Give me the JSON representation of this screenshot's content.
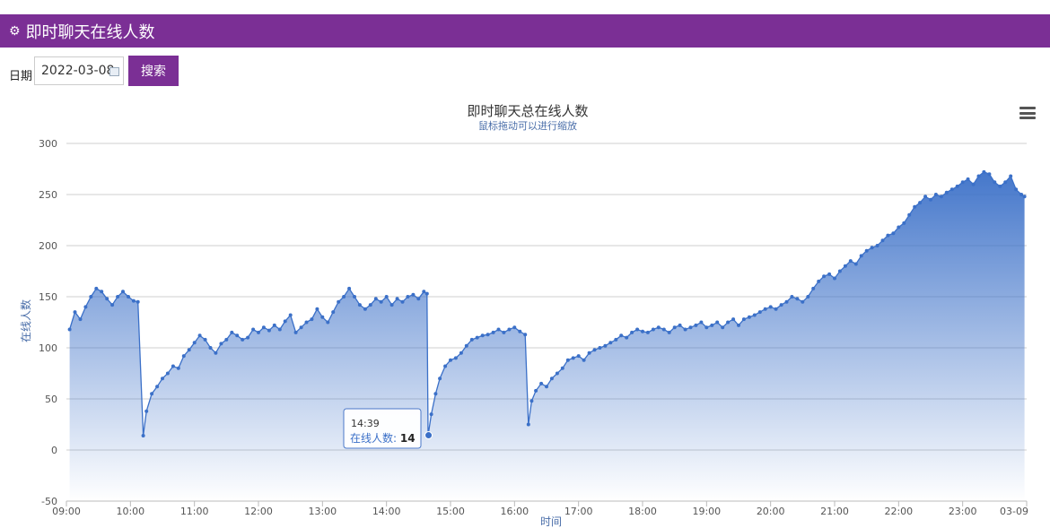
{
  "header": {
    "title": "即时聊天在线人数",
    "icon": "cogs-icon"
  },
  "toolbar": {
    "date_label": "日期",
    "date_value": "2022-03-08",
    "search_label": "搜索"
  },
  "colors": {
    "brand": "#7b2f95",
    "series": "#3b70c8"
  },
  "chart_data": {
    "type": "area",
    "title": "即时聊天总在线人数",
    "subtitle": "鼠标拖动可以进行缩放",
    "xlabel": "时间",
    "ylabel": "在线人数",
    "ylim": [
      -50,
      300
    ],
    "yticks": [
      -50,
      0,
      50,
      100,
      150,
      200,
      250,
      300
    ],
    "xlim": [
      "09:00",
      "24:00"
    ],
    "xticks": [
      {
        "t": "09:00",
        "label": "09:00"
      },
      {
        "t": "10:00",
        "label": "10:00"
      },
      {
        "t": "11:00",
        "label": "11:00"
      },
      {
        "t": "12:00",
        "label": "12:00"
      },
      {
        "t": "13:00",
        "label": "13:00"
      },
      {
        "t": "14:00",
        "label": "14:00"
      },
      {
        "t": "15:00",
        "label": "15:00"
      },
      {
        "t": "16:00",
        "label": "16:00"
      },
      {
        "t": "17:00",
        "label": "17:00"
      },
      {
        "t": "18:00",
        "label": "18:00"
      },
      {
        "t": "19:00",
        "label": "19:00"
      },
      {
        "t": "20:00",
        "label": "20:00"
      },
      {
        "t": "21:00",
        "label": "21:00"
      },
      {
        "t": "22:00",
        "label": "22:00"
      },
      {
        "t": "23:00",
        "label": "23:00"
      },
      {
        "t": "24:00",
        "label": "03-09"
      }
    ],
    "grid": true,
    "legend": false,
    "series": [
      {
        "values": [
          [
            "09:03",
            118
          ],
          [
            "09:08",
            135
          ],
          [
            "09:13",
            128
          ],
          [
            "09:18",
            140
          ],
          [
            "09:23",
            150
          ],
          [
            "09:28",
            158
          ],
          [
            "09:33",
            155
          ],
          [
            "09:38",
            148
          ],
          [
            "09:43",
            142
          ],
          [
            "09:48",
            150
          ],
          [
            "09:53",
            155
          ],
          [
            "09:58",
            150
          ],
          [
            "10:03",
            146
          ],
          [
            "10:07",
            145
          ],
          [
            "10:12",
            14
          ],
          [
            "10:15",
            38
          ],
          [
            "10:20",
            55
          ],
          [
            "10:25",
            62
          ],
          [
            "10:30",
            70
          ],
          [
            "10:35",
            75
          ],
          [
            "10:40",
            82
          ],
          [
            "10:45",
            80
          ],
          [
            "10:50",
            92
          ],
          [
            "10:55",
            98
          ],
          [
            "11:00",
            105
          ],
          [
            "11:05",
            112
          ],
          [
            "11:10",
            108
          ],
          [
            "11:15",
            100
          ],
          [
            "11:20",
            95
          ],
          [
            "11:25",
            104
          ],
          [
            "11:30",
            108
          ],
          [
            "11:35",
            115
          ],
          [
            "11:40",
            112
          ],
          [
            "11:45",
            108
          ],
          [
            "11:50",
            110
          ],
          [
            "11:55",
            118
          ],
          [
            "12:00",
            115
          ],
          [
            "12:05",
            120
          ],
          [
            "12:10",
            117
          ],
          [
            "12:15",
            122
          ],
          [
            "12:20",
            118
          ],
          [
            "12:25",
            126
          ],
          [
            "12:30",
            132
          ],
          [
            "12:35",
            115
          ],
          [
            "12:40",
            120
          ],
          [
            "12:45",
            125
          ],
          [
            "12:50",
            128
          ],
          [
            "12:55",
            138
          ],
          [
            "13:00",
            130
          ],
          [
            "13:05",
            125
          ],
          [
            "13:10",
            135
          ],
          [
            "13:15",
            145
          ],
          [
            "13:20",
            150
          ],
          [
            "13:25",
            158
          ],
          [
            "13:30",
            150
          ],
          [
            "13:35",
            142
          ],
          [
            "13:40",
            138
          ],
          [
            "13:45",
            142
          ],
          [
            "13:50",
            148
          ],
          [
            "13:55",
            145
          ],
          [
            "14:00",
            150
          ],
          [
            "14:05",
            142
          ],
          [
            "14:10",
            148
          ],
          [
            "14:15",
            145
          ],
          [
            "14:20",
            150
          ],
          [
            "14:25",
            152
          ],
          [
            "14:30",
            148
          ],
          [
            "14:35",
            155
          ],
          [
            "14:38",
            153
          ],
          [
            "14:39",
            14
          ],
          [
            "14:42",
            35
          ],
          [
            "14:46",
            55
          ],
          [
            "14:50",
            70
          ],
          [
            "14:55",
            82
          ],
          [
            "15:00",
            88
          ],
          [
            "15:05",
            90
          ],
          [
            "15:10",
            95
          ],
          [
            "15:15",
            102
          ],
          [
            "15:20",
            108
          ],
          [
            "15:25",
            110
          ],
          [
            "15:30",
            112
          ],
          [
            "15:35",
            113
          ],
          [
            "15:40",
            115
          ],
          [
            "15:45",
            118
          ],
          [
            "15:50",
            115
          ],
          [
            "15:55",
            118
          ],
          [
            "16:00",
            120
          ],
          [
            "16:05",
            116
          ],
          [
            "16:10",
            113
          ],
          [
            "16:13",
            25
          ],
          [
            "16:16",
            48
          ],
          [
            "16:20",
            58
          ],
          [
            "16:25",
            65
          ],
          [
            "16:30",
            62
          ],
          [
            "16:35",
            70
          ],
          [
            "16:40",
            75
          ],
          [
            "16:45",
            80
          ],
          [
            "16:50",
            88
          ],
          [
            "16:55",
            90
          ],
          [
            "17:00",
            92
          ],
          [
            "17:05",
            88
          ],
          [
            "17:10",
            95
          ],
          [
            "17:15",
            98
          ],
          [
            "17:20",
            100
          ],
          [
            "17:25",
            102
          ],
          [
            "17:30",
            105
          ],
          [
            "17:35",
            108
          ],
          [
            "17:40",
            112
          ],
          [
            "17:45",
            110
          ],
          [
            "17:50",
            115
          ],
          [
            "17:55",
            118
          ],
          [
            "18:00",
            116
          ],
          [
            "18:05",
            115
          ],
          [
            "18:10",
            118
          ],
          [
            "18:15",
            120
          ],
          [
            "18:20",
            118
          ],
          [
            "18:25",
            115
          ],
          [
            "18:30",
            120
          ],
          [
            "18:35",
            122
          ],
          [
            "18:40",
            118
          ],
          [
            "18:45",
            120
          ],
          [
            "18:50",
            122
          ],
          [
            "18:55",
            125
          ],
          [
            "19:00",
            120
          ],
          [
            "19:05",
            122
          ],
          [
            "19:10",
            125
          ],
          [
            "19:15",
            120
          ],
          [
            "19:20",
            125
          ],
          [
            "19:25",
            128
          ],
          [
            "19:30",
            122
          ],
          [
            "19:35",
            128
          ],
          [
            "19:40",
            130
          ],
          [
            "19:45",
            132
          ],
          [
            "19:50",
            135
          ],
          [
            "19:55",
            138
          ],
          [
            "20:00",
            140
          ],
          [
            "20:05",
            138
          ],
          [
            "20:10",
            142
          ],
          [
            "20:15",
            145
          ],
          [
            "20:20",
            150
          ],
          [
            "20:25",
            148
          ],
          [
            "20:30",
            145
          ],
          [
            "20:35",
            150
          ],
          [
            "20:40",
            158
          ],
          [
            "20:45",
            165
          ],
          [
            "20:50",
            170
          ],
          [
            "20:55",
            172
          ],
          [
            "21:00",
            168
          ],
          [
            "21:05",
            175
          ],
          [
            "21:10",
            180
          ],
          [
            "21:15",
            185
          ],
          [
            "21:20",
            182
          ],
          [
            "21:25",
            190
          ],
          [
            "21:30",
            195
          ],
          [
            "21:35",
            198
          ],
          [
            "21:40",
            200
          ],
          [
            "21:45",
            205
          ],
          [
            "21:50",
            210
          ],
          [
            "21:55",
            212
          ],
          [
            "22:00",
            218
          ],
          [
            "22:05",
            222
          ],
          [
            "22:10",
            230
          ],
          [
            "22:15",
            238
          ],
          [
            "22:20",
            242
          ],
          [
            "22:25",
            248
          ],
          [
            "22:30",
            245
          ],
          [
            "22:35",
            250
          ],
          [
            "22:40",
            248
          ],
          [
            "22:45",
            252
          ],
          [
            "22:50",
            255
          ],
          [
            "22:55",
            258
          ],
          [
            "23:00",
            262
          ],
          [
            "23:05",
            265
          ],
          [
            "23:10",
            260
          ],
          [
            "23:15",
            268
          ],
          [
            "23:20",
            272
          ],
          [
            "23:25",
            270
          ],
          [
            "23:30",
            262
          ],
          [
            "23:35",
            258
          ],
          [
            "23:40",
            262
          ],
          [
            "23:45",
            268
          ],
          [
            "23:50",
            255
          ],
          [
            "23:55",
            250
          ],
          [
            "23:58",
            248
          ]
        ]
      }
    ],
    "tooltip": {
      "time": "14:39",
      "series_name": "在线人数",
      "value": 14
    }
  }
}
